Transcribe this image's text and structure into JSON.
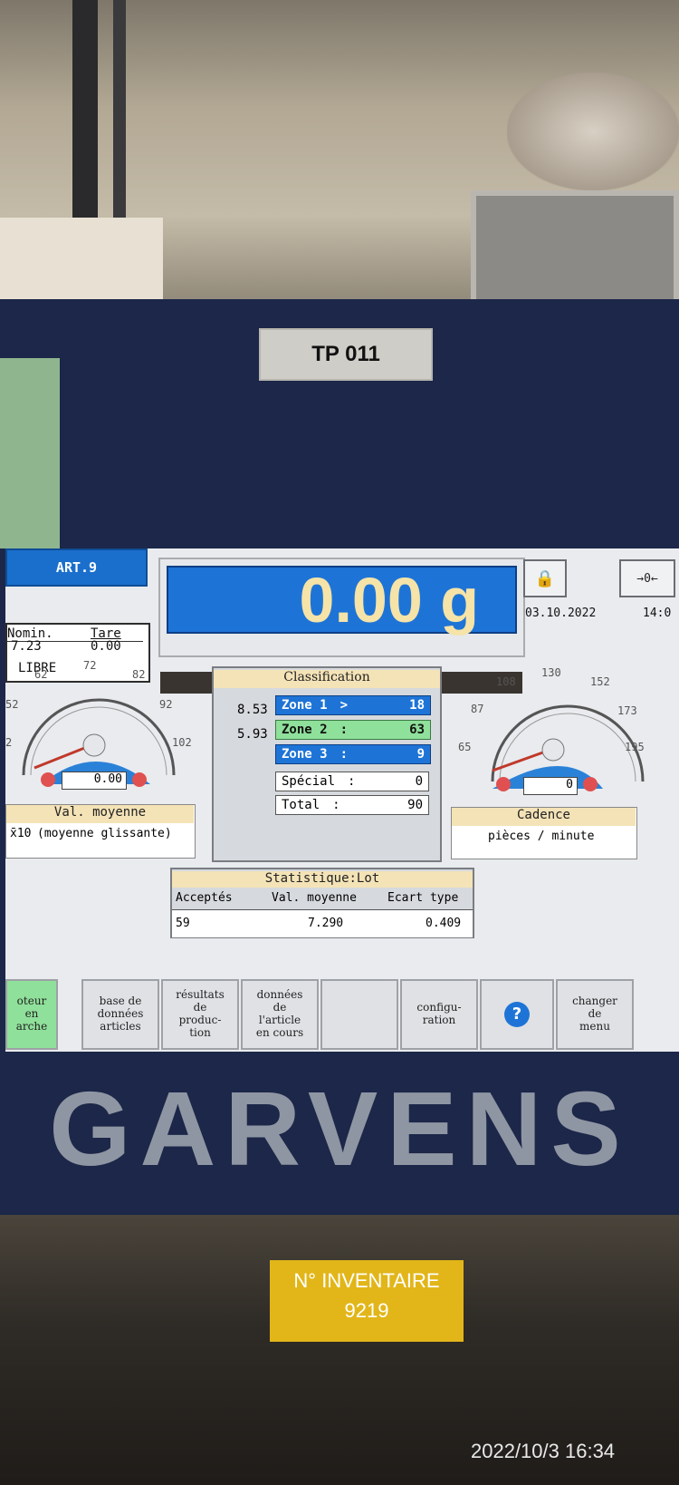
{
  "device_label": "TP 011",
  "article": {
    "label": "ART.9"
  },
  "nominal": {
    "header_nomin": "Nomin.",
    "header_tare": "Tare",
    "nomin_value": "7.23",
    "tare_value": "0.00",
    "status": "LIBRE"
  },
  "weight": {
    "value": "0.00 g"
  },
  "lock_icon": "lock-icon",
  "zero_icon_text": "→0←",
  "datetime": {
    "date": "03.10.2022",
    "time": "14:0"
  },
  "gauge_left": {
    "ticks": [
      "62",
      "72",
      "82",
      "52",
      "92",
      "2",
      "102"
    ],
    "value": "0.00",
    "label_title": "Val. moyenne",
    "label_sub": "(moyenne glissante)",
    "label_prefix": "x̄10"
  },
  "classification": {
    "title": "Classification",
    "limits": [
      "8.53",
      "5.93"
    ],
    "zones": [
      {
        "name": "Zone 1",
        "sep": ">",
        "count": "18",
        "color": "#1e74d6"
      },
      {
        "name": "Zone 2",
        "sep": ":",
        "count": "63",
        "color": "#8fe09a"
      },
      {
        "name": "Zone 3",
        "sep": ":",
        "count": "9",
        "color": "#1e74d6"
      }
    ],
    "special": {
      "label": "Spécial",
      "sep": ":",
      "value": "0"
    },
    "total": {
      "label": "Total",
      "sep": ":",
      "value": "90"
    }
  },
  "gauge_right": {
    "ticks": [
      "108",
      "130",
      "152",
      "87",
      "173",
      "65",
      "195"
    ],
    "value": "0",
    "label_title": "Cadence",
    "label_sub": "pièces / minute"
  },
  "statistics": {
    "title": "Statistique:Lot",
    "headers": [
      "Acceptés",
      "Val. moyenne",
      "Ecart type"
    ],
    "values": [
      "59",
      "7.290",
      "0.409"
    ]
  },
  "softkeys": [
    {
      "label": "oteur\nen\narche",
      "active": true
    },
    {
      "label": "base de\ndonnées\narticles"
    },
    {
      "label": "résultats\nde\nproduc-\ntion"
    },
    {
      "label": "données\nde\nl'article\nen cours"
    },
    {
      "label": ""
    },
    {
      "label": "configu-\nration"
    },
    {
      "label": "?"
    },
    {
      "label": "changer\nde\nmenu"
    }
  ],
  "brand": "GARVENS",
  "inventory": {
    "line1": "N° INVENTAIRE",
    "line2": "9219"
  },
  "photo_timestamp": "2022/10/3 16:34"
}
